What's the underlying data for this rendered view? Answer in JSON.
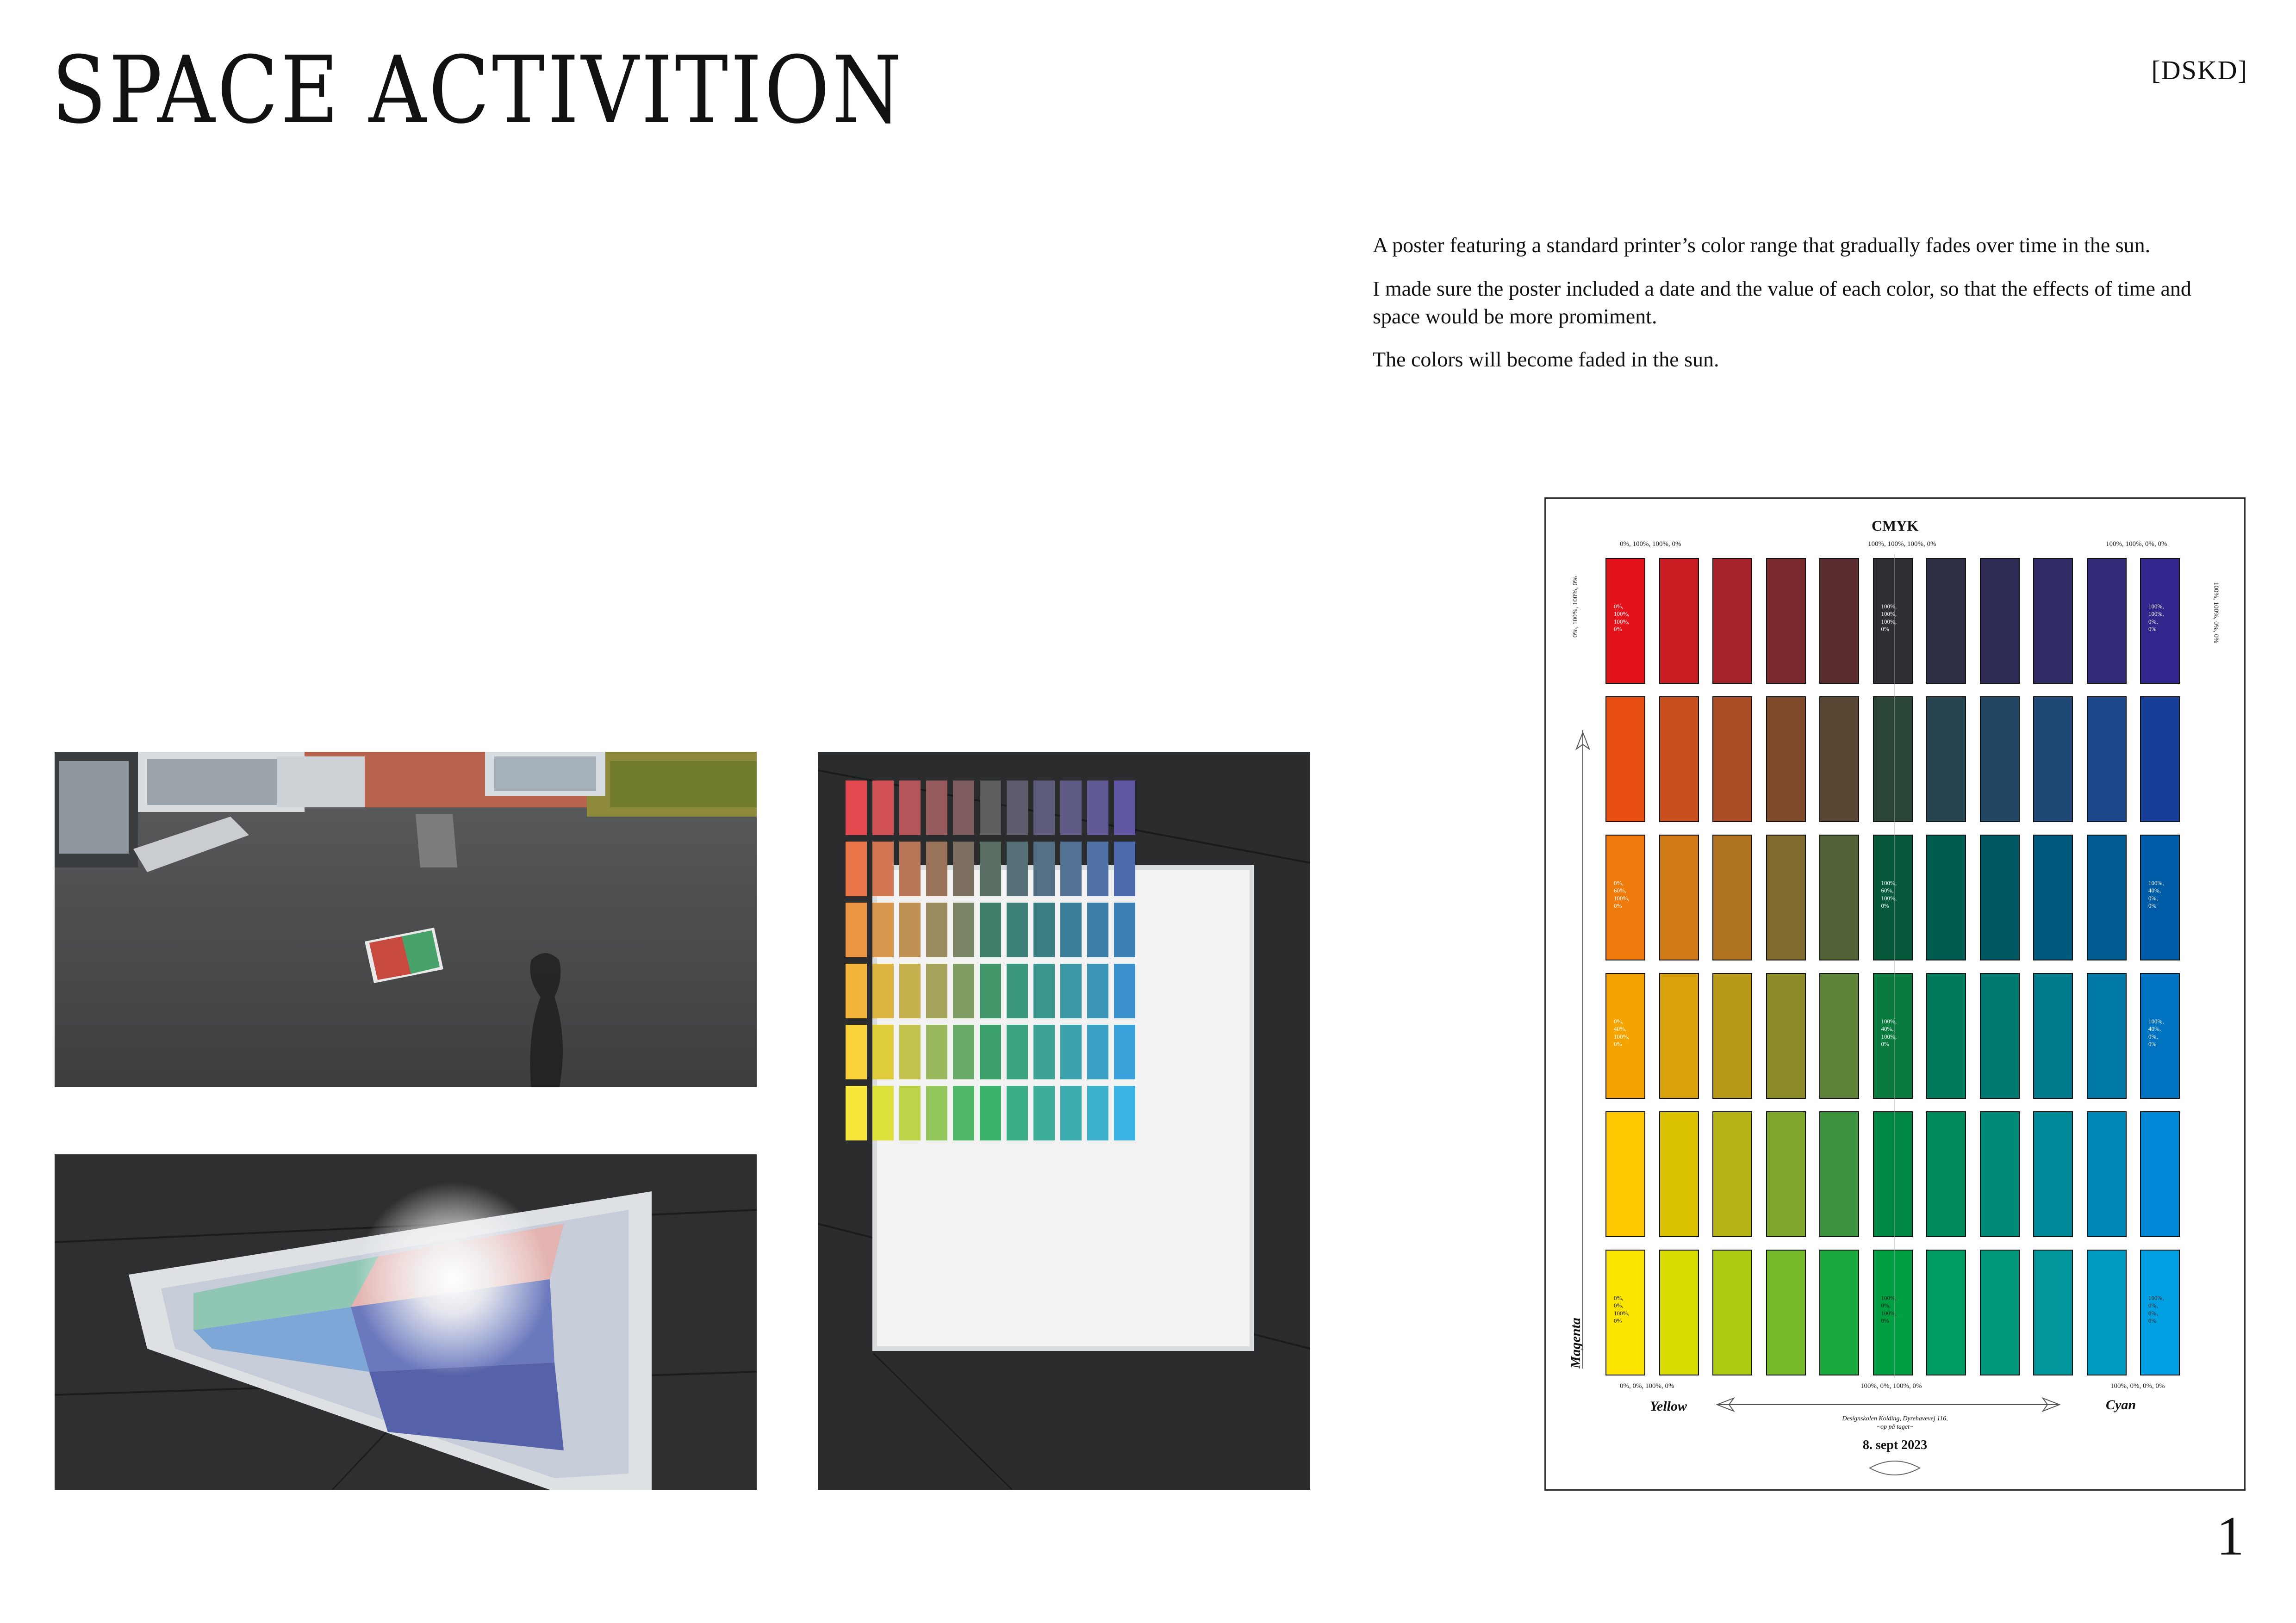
{
  "page": {
    "title": "SPACE ACTIVITION",
    "mark": "[DSKD]",
    "page_number": "1",
    "paragraphs": [
      "A poster featuring a standard printer’s color range that gradually fades over time in the sun.",
      "I made sure the poster included a date and the value of each color, so that the effects of time and space would be more promiment.",
      "The colors will become faded in the sun."
    ]
  },
  "photos": {
    "rooftop": {
      "description": "Rooftop with poster lying on the roof"
    },
    "angled": {
      "description": "Poster photographed at an angle with sun glare"
    },
    "topdown": {
      "description": "Poster photographed from above on roofing"
    }
  },
  "poster": {
    "title": "CMYK",
    "corner_top_left": "0%, 100%, 100%, 0%",
    "corner_top_center": "100%, 100%, 100%, 0%",
    "corner_top_right": "100%, 100%, 0%, 0%",
    "side_left": "0%, 100%, 100%, 0%",
    "side_right": "100%, 100%, 0%, 0%",
    "corner_bottom_left": "0%, 0%, 100%, 0%",
    "corner_bottom_center": "100%, 0%, 100%, 0%",
    "corner_bottom_right": "100%, 0%, 0%, 0%",
    "axis_magenta": "Magenta",
    "axis_yellow": "Yellow",
    "axis_cyan": "Cyan",
    "address": "Designskolen Kolding, Dyrehavevej 116,\n~op på taget~",
    "date": "8. sept 2023",
    "labels": {
      "r0c0": "0%,\n100%,\n100%,\n0%",
      "r0c5": "100%,\n100%,\n100%,\n0%",
      "r0c10": "100%,\n100%,\n0%,\n0%",
      "r2c0": "0%,\n60%,\n100%,\n0%",
      "r2c5": "100%,\n60%,\n100%,\n0%",
      "r2c10": "100%,\n40%,\n0%,\n0%",
      "r3c0": "0%,\n40%,\n100%,\n0%",
      "r3c5": "100%,\n40%,\n100%,\n0%",
      "r3c10": "100%,\n40%,\n0%,\n0%",
      "r5c5": "100%,\n0%,\n100%,\n0%",
      "r5c10": "100%,\n0%,\n0%,\n0%",
      "r5c0": "0%,\n0%,\n100%,\n0%"
    },
    "swatches": [
      [
        "#e2131b",
        "#c81d22",
        "#a4232a",
        "#7a2a2c",
        "#5a2c30",
        "#2f2f33",
        "#2e2e44",
        "#2e2c55",
        "#2f2b66",
        "#302a79",
        "#31268c"
      ],
      [
        "#e84e12",
        "#c94e1d",
        "#a84d25",
        "#7e4a2a",
        "#584632",
        "#284536",
        "#264550",
        "#234763",
        "#1f4877",
        "#1c488b",
        "#173f98"
      ],
      [
        "#ee7a0c",
        "#d07a17",
        "#b07321",
        "#806a2d",
        "#526237",
        "#065a3b",
        "#005b50",
        "#005962",
        "#005a7d",
        "#005b91",
        "#005ba6"
      ],
      [
        "#f5a300",
        "#d9a10a",
        "#b79b18",
        "#8b8c28",
        "#5b8236",
        "#0b7a3e",
        "#00795a",
        "#007a70",
        "#007b8e",
        "#0078a6",
        "#0073c0"
      ],
      [
        "#fec900",
        "#dac100",
        "#b4b419",
        "#7ea52d",
        "#3d943e",
        "#008742",
        "#008b5e",
        "#008a78",
        "#008a99",
        "#0089b8",
        "#0088d6"
      ],
      [
        "#fbe500",
        "#d8dc00",
        "#adcb12",
        "#76b92a",
        "#1aa73c",
        "#00a042",
        "#009a63",
        "#00977c",
        "#00969c",
        "#009bc0",
        "#00a0e3"
      ]
    ]
  }
}
